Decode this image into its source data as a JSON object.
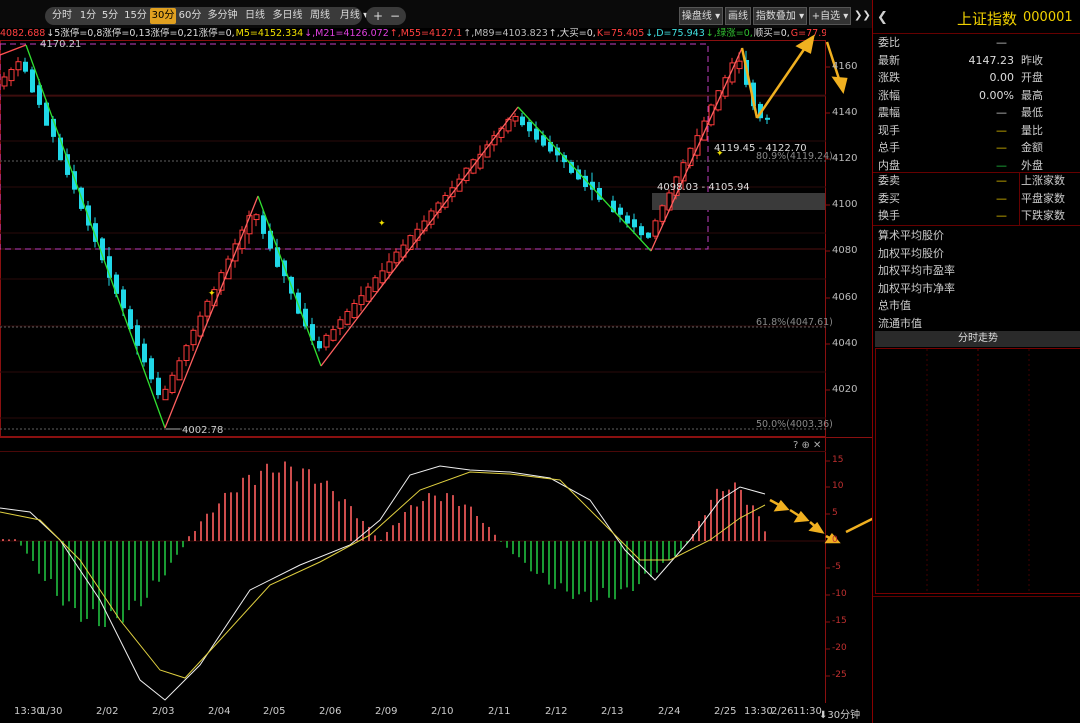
{
  "toolbar": {
    "periods": [
      "分时",
      "1分",
      "5分",
      "15分",
      "30分",
      "60分",
      "多分钟",
      "日线",
      "多日线",
      "周线",
      "月线 ▾"
    ],
    "selected_period": "30分",
    "zoom_in": "+",
    "zoom_out": "−",
    "right_buttons": [
      "操盘线 ▾",
      "画线",
      "指数叠加 ▾",
      "+自选 ▾"
    ],
    "collapse": "❯❯"
  },
  "indicator_line": [
    {
      "text": "4082.688",
      "color": "#ff4040"
    },
    {
      "text": "↓5涨停=0,8涨停=0,13涨停=0,21涨停=0,",
      "color": "#dddddd"
    },
    {
      "text": "M5=4152.334",
      "color": "#f0e000"
    },
    {
      "text": "↓,M21=4126.072",
      "color": "#e040e0"
    },
    {
      "text": "↑,M55=4127.1",
      "color": "#ff4040"
    },
    {
      "text": "↑,M89=4103.823",
      "color": "#bbbbbb"
    },
    {
      "text": "↑,大买=0,",
      "color": "#dddddd"
    },
    {
      "text": "K=75.405",
      "color": "#ff4040"
    },
    {
      "text": "↓,D=75.943",
      "color": "#40e0e0"
    },
    {
      "text": "↓,绿涨=0,",
      "color": "#30c030"
    },
    {
      "text": "顺买=0,",
      "color": "#dddddd"
    },
    {
      "text": "G=77.931",
      "color": "#ff4040"
    },
    {
      "text": "↓,小买=0,底背=0",
      "color": "#dddddd"
    }
  ],
  "price_axis": [
    "4160",
    "4140",
    "4120",
    "4100",
    "4080",
    "4060",
    "4040",
    "4020"
  ],
  "macd_axis": [
    "15",
    "10",
    "5",
    "0",
    "-5",
    "-10",
    "-15",
    "-20",
    "-25"
  ],
  "annotations": {
    "high": "4170.21",
    "low": "4002.78",
    "range_hi": "4119.45 - 4122.70",
    "range_lo": "4098.03 - 4105.94",
    "fib_80": "80.9%(4119.24)",
    "fib_61": "61.8%(4047.61)",
    "fib_50": "50.0%(4003.36)"
  },
  "macd_header": "? ⊕ ✕",
  "date_axis": [
    "13:30",
    "1/30",
    "2/02",
    "2/03",
    "2/04",
    "2/05",
    "2/06",
    "2/09",
    "2/10",
    "2/11",
    "2/12",
    "2/13",
    "2/24",
    "2/25",
    "13:30",
    "2/26",
    "11:30",
    "⬇30分钟"
  ],
  "panel": {
    "back": "❮",
    "name": "上证指数",
    "code": "000001",
    "rows": [
      {
        "l1": "委比",
        "v1": "—",
        "l2": ""
      },
      {
        "l1": "最新",
        "v1": "4147.23",
        "l2": "昨收"
      },
      {
        "l1": "涨跌",
        "v1": "0.00",
        "l2": "开盘"
      },
      {
        "l1": "涨幅",
        "v1": "0.00%",
        "l2": "最高"
      },
      {
        "l1": "震幅",
        "v1": "—",
        "l2": "最低"
      },
      {
        "l1": "现手",
        "v1": "—",
        "l2": "量比"
      },
      {
        "l1": "总手",
        "v1": "—",
        "l2": "金额"
      },
      {
        "l1": "内盘",
        "v1": "—",
        "l2": "外盘"
      }
    ],
    "rows2": [
      {
        "l1": "委卖",
        "v1": "—",
        "l2": "上涨家数"
      },
      {
        "l1": "委买",
        "v1": "—",
        "l2": "平盘家数"
      },
      {
        "l1": "换手",
        "v1": "—",
        "l2": "下跌家数"
      }
    ],
    "list": [
      "算术平均股价",
      "加权平均股价",
      "加权平均市盈率",
      "加权平均市净率",
      "总市值",
      "流通市值"
    ],
    "time_header": "分时走势"
  }
}
